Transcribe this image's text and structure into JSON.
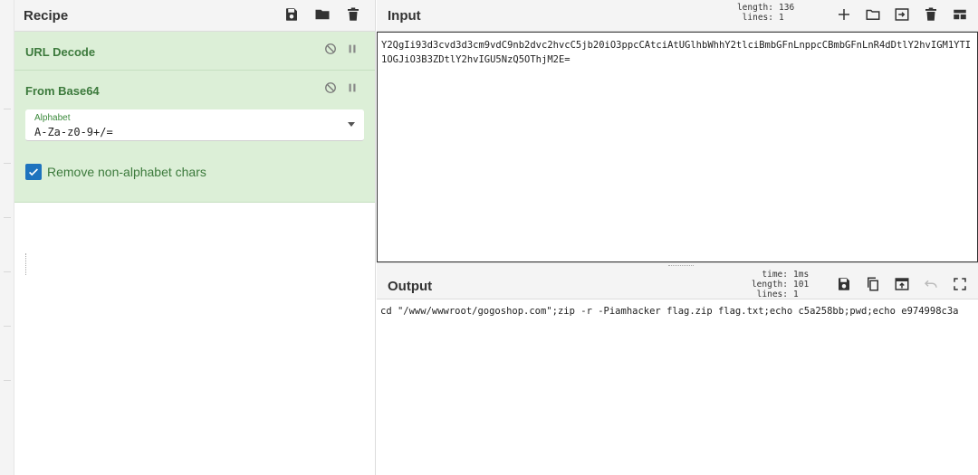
{
  "recipe": {
    "title": "Recipe",
    "operations": [
      {
        "name": "URL Decode"
      },
      {
        "name": "From Base64",
        "alphabet_label": "Alphabet",
        "alphabet_value": "A-Za-z0-9+/=",
        "remove_label": "Remove non-alphabet chars",
        "remove_checked": true
      }
    ]
  },
  "input": {
    "title": "Input",
    "length_label": "length:",
    "length": "136",
    "lines_label": "lines:",
    "lines": "1",
    "text": "Y2QgIi93d3cvd3d3cm9vdC9nb2dvc2hvcC5jb20iO3ppcCAtciAtUGlhbWhhY2tlciBmbGFnLnppcCBmbGFnLnR4dDtlY2hvIGM1YTI1OGJiO3B3ZDtlY2hvIGU5NzQ5OThjM2E="
  },
  "output": {
    "title": "Output",
    "time_label": "time:",
    "time": "1ms",
    "length_label": "length:",
    "length": "101",
    "lines_label": "lines:",
    "lines": "1",
    "text": "cd \"/www/wwwroot/gogoshop.com\";zip -r -Piamhacker flag.zip flag.txt;echo c5a258bb;pwd;echo e974998c3a"
  },
  "colors": {
    "accent_green": "#3c7a3c",
    "op_background": "#dcefd7",
    "checkbox_blue": "#1e73be"
  },
  "icons": {
    "recipe_header": [
      "save-icon",
      "folder-icon",
      "trash-icon"
    ],
    "op_controls": [
      "disable-icon",
      "pause-icon"
    ],
    "input_header": [
      "plus-icon",
      "folder-open-icon",
      "import-icon",
      "trash-icon",
      "layout-icon"
    ],
    "output_header": [
      "save-icon",
      "copy-icon",
      "replace-input-icon",
      "undo-icon",
      "fullscreen-icon"
    ]
  }
}
